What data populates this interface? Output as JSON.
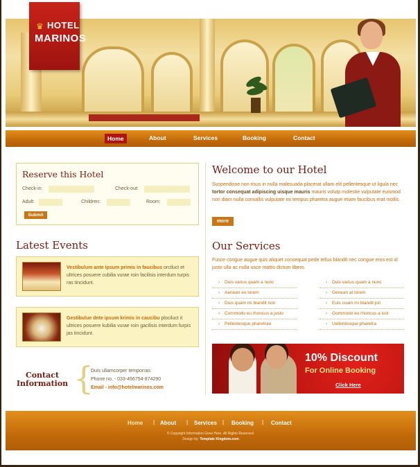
{
  "brand": {
    "line1": "HOTEL",
    "line2": "MARINOS"
  },
  "nav": [
    "Home",
    "About",
    "Services",
    "Booking",
    "Contact"
  ],
  "reserve": {
    "title": "Reserve this Hotel",
    "checkin": "Check-in:",
    "checkout": "Check-out:",
    "adult": "Adult:",
    "children": "Children:",
    "room": "Room:",
    "submit": "Submit"
  },
  "events": {
    "title": "Latest Events",
    "items": [
      {
        "bold": "Vestibulum ante ipsum primis in faucibus",
        "rest": " orciluct et ultrices posuere cubilia vurae roin facilisis interdum turpis ras tincidunt."
      },
      {
        "bold": "Gestibulue dnte ipsum krimis in caucibu",
        "rest": " plociluct it ultrices posuere kubilia vurae roin gacilisis interdum furpis jas tincidunt."
      }
    ]
  },
  "contact": {
    "title": "Contact Information",
    "line1": "Duis ullamcorper temporras",
    "line2": "Phone no. - 033-456754-874290",
    "line3": "Email - info@hotelmarinos.com"
  },
  "welcome": {
    "title": "Welcome to our Hotel",
    "p1": "Suspendisse non risus in nulla malesuada placerat ullam elit pellentesque ut ligula nec ",
    "p1_bold": "tortor consequat adipiscing uisque mauris",
    "p1_rest": " mauris volutp molestie vulputate euismod non diam nulla convallis vulputate mi tempus pharetra augue etiam faucibus erat mollis.",
    "more": "more"
  },
  "services": {
    "title": "Our Services",
    "intro": "Fusce congue augue quis aliquet consequat pede tellus blandit nec congue eros est id justo ulla ac nulla usce mattis dictum libero.",
    "left": [
      "Duis varius quam a nunc",
      "Aenean eu lorem",
      "Duis quam mi blandit non",
      "Commodo eu rhoncus a justo",
      "Pellentesque pharetrao"
    ],
    "right": [
      "Duis varius quam a nunc",
      "Genean at lorem",
      "Euis cuam mi blandit jon",
      "Gommodo eu rhoncus a iust",
      "Uellentesque pharetra"
    ]
  },
  "discount": {
    "title": "10% Discount",
    "subtitle": "For Online Booking",
    "link": "Click Here"
  },
  "footer": {
    "nav": [
      "Home",
      "About",
      "Services",
      "Booking",
      "Contact"
    ],
    "copyright": "© Copyright Information Goes Here. All Rights Reserved.",
    "design_label": "Design by:",
    "design_by": "Template Kingdom.com"
  },
  "colors": {
    "accent": "#c97616",
    "brand_red": "#b0140e",
    "heading": "#7a1a10"
  }
}
